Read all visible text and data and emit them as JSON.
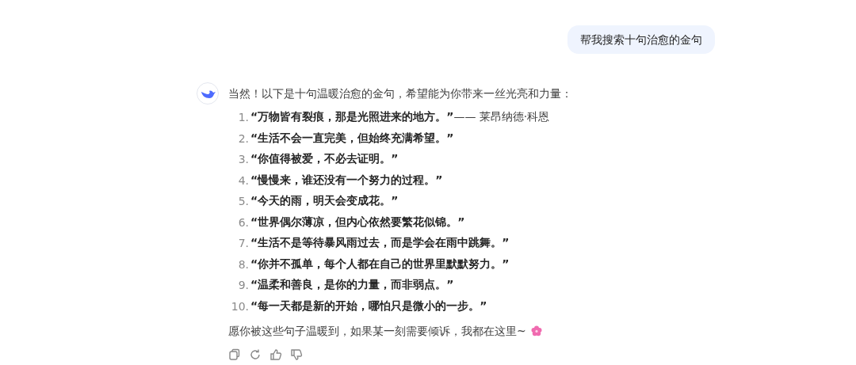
{
  "user_message": "帮我搜索十句治愈的金句",
  "reply": {
    "intro": "当然！以下是十句温暖治愈的金句，希望能为你带来一丝光亮和力量：",
    "quotes": [
      {
        "number": "1.",
        "quote": "“万物皆有裂痕，那是光照进来的地方。”",
        "attribution": "—— 莱昂纳德·科恩"
      },
      {
        "number": "2.",
        "quote": "“生活不会一直完美，但始终充满希望。”"
      },
      {
        "number": "3.",
        "quote": "“你值得被爱，不必去证明。”"
      },
      {
        "number": "4.",
        "quote": "“慢慢来，谁还没有一个努力的过程。”"
      },
      {
        "number": "5.",
        "quote": "“今天的雨，明天会变成花。”"
      },
      {
        "number": "6.",
        "quote": "“世界偶尔薄凉，但内心依然要繁花似锦。”"
      },
      {
        "number": "7.",
        "quote": "“生活不是等待暴风雨过去，而是学会在雨中跳舞。”"
      },
      {
        "number": "8.",
        "quote": "“你并不孤单，每个人都在自己的世界里默默努力。”"
      },
      {
        "number": "9.",
        "quote": "“温柔和善良，是你的力量，而非弱点。”"
      },
      {
        "number": "10.",
        "quote": "“每一天都是新的开始，哪怕只是微小的一步。”"
      }
    ],
    "closing": "愿你被这些句子温暖到，如果某一刻需要倾诉，我都在这里~"
  }
}
